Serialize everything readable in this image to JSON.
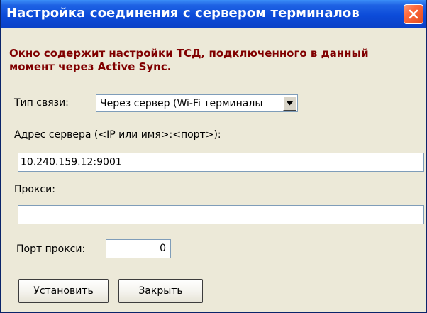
{
  "window": {
    "title": "Настройка соединения с сервером терминалов"
  },
  "info": {
    "text": "Окно содержит настройки ТСД, подключенного в данный\nмомент через Active Sync."
  },
  "connection_type": {
    "label": "Тип связи:",
    "selected": "Через сервер (Wi-Fi терминалы"
  },
  "server_address": {
    "label": "Адрес сервера (<IP или имя>:<порт>):",
    "value": "10.240.159.12:9001"
  },
  "proxy": {
    "label": "Прокси:",
    "value": ""
  },
  "proxy_port": {
    "label": "Порт прокси:",
    "value": "0"
  },
  "buttons": {
    "set_label": "Установить",
    "close_label": "Закрыть"
  },
  "icons": {
    "close": "close-icon",
    "dropdown": "chevron-down-icon"
  },
  "colors": {
    "title_bar": "#0c4bd9",
    "close_button": "#e14c1f",
    "info_text": "#800000",
    "background": "#ece9d8"
  }
}
